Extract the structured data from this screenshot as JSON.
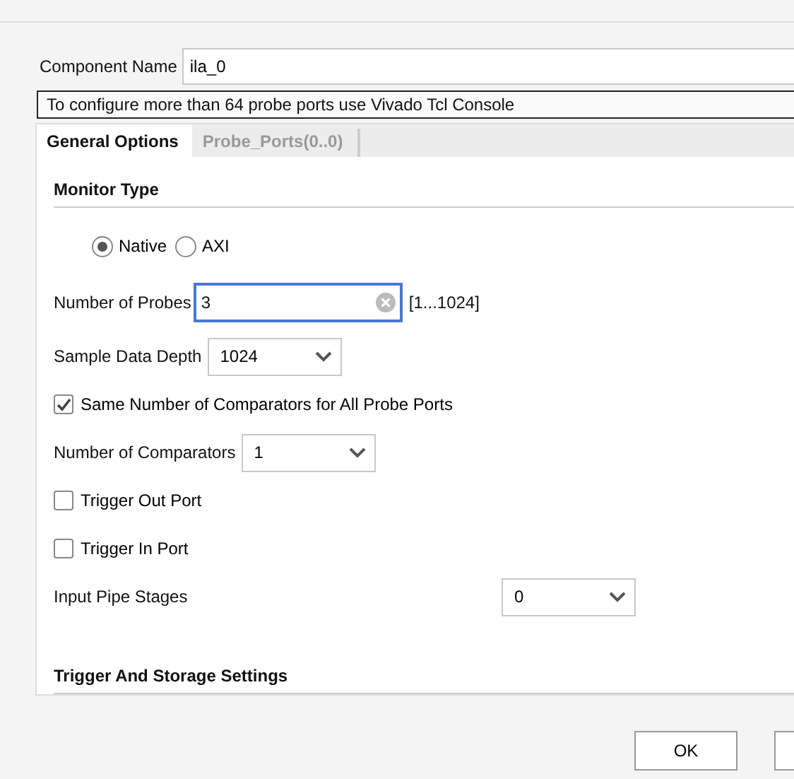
{
  "component_name": {
    "label": "Component Name",
    "value": "ila_0"
  },
  "notice": "To configure more than 64 probe ports use Vivado Tcl Console",
  "tabs": [
    {
      "label": "General Options",
      "selected": true
    },
    {
      "label": "Probe_Ports(0..0)",
      "selected": false
    }
  ],
  "monitor_type": {
    "title": "Monitor Type",
    "options": [
      {
        "label": "Native",
        "selected": true
      },
      {
        "label": "AXI",
        "selected": false
      }
    ]
  },
  "fields": [
    {
      "kind": "text",
      "label": "Number of Probes",
      "value": "3",
      "range": "[1...1024]",
      "focused": true
    },
    {
      "kind": "select",
      "label": "Sample Data Depth",
      "value": "1024"
    },
    {
      "kind": "checkbox",
      "label": "Same Number of Comparators for All Probe Ports",
      "checked": true
    },
    {
      "kind": "select",
      "label": "Number of Comparators",
      "value": "1"
    },
    {
      "kind": "checkbox",
      "label": "Trigger Out Port",
      "checked": false
    },
    {
      "kind": "checkbox",
      "label": "Trigger In Port",
      "checked": false
    },
    {
      "kind": "column_select",
      "label": "Input Pipe Stages",
      "value": "0"
    }
  ],
  "next_section": {
    "title": "Trigger And Storage Settings"
  },
  "buttons": [
    {
      "label": "OK"
    }
  ]
}
